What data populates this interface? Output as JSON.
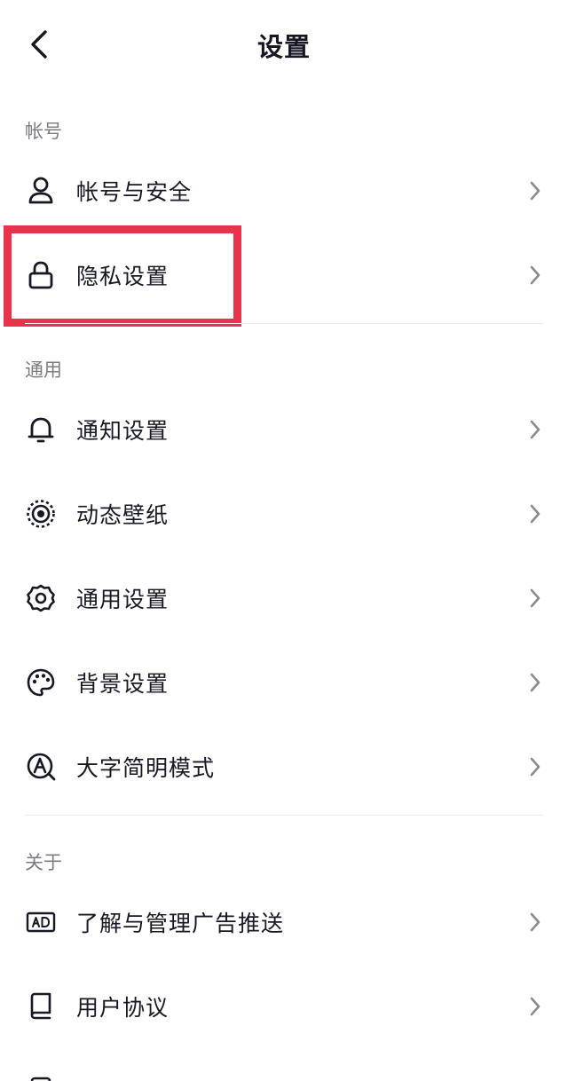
{
  "header": {
    "title": "设置"
  },
  "sections": {
    "account": {
      "title": "帐号",
      "items": [
        {
          "label": "帐号与安全",
          "icon": "person-icon"
        },
        {
          "label": "隐私设置",
          "icon": "lock-icon"
        }
      ]
    },
    "general": {
      "title": "通用",
      "items": [
        {
          "label": "通知设置",
          "icon": "bell-icon"
        },
        {
          "label": "动态壁纸",
          "icon": "live-wallpaper-icon"
        },
        {
          "label": "通用设置",
          "icon": "gear-icon"
        },
        {
          "label": "背景设置",
          "icon": "palette-icon"
        },
        {
          "label": "大字简明模式",
          "icon": "large-text-icon"
        }
      ]
    },
    "about": {
      "title": "关于",
      "items": [
        {
          "label": "了解与管理广告推送",
          "icon": "ad-icon"
        },
        {
          "label": "用户协议",
          "icon": "book-icon"
        },
        {
          "label": "",
          "icon": "document-icon"
        }
      ]
    }
  },
  "colors": {
    "highlight": "#e8334a",
    "text": "#161823",
    "muted": "#7b7c82",
    "divider": "#ececec"
  }
}
